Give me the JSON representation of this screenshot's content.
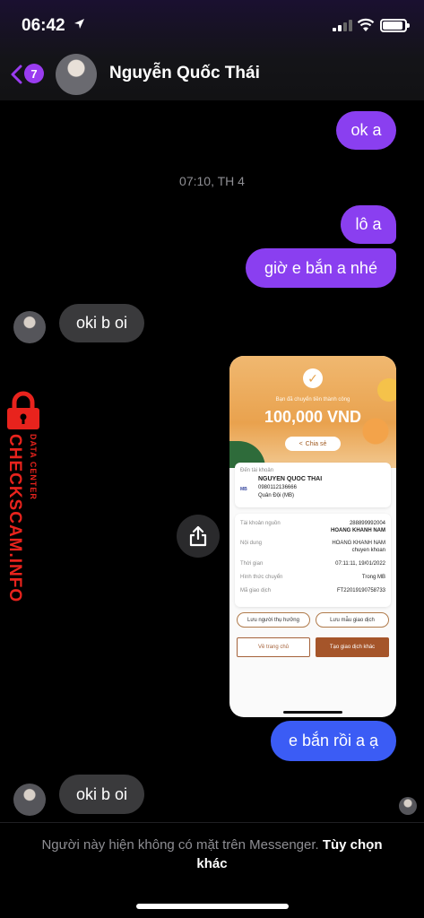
{
  "status_bar": {
    "time": "06:42"
  },
  "header": {
    "back_badge": "7",
    "contact_name": "Nguyễn Quốc Thái"
  },
  "messages": {
    "m1": "ok a",
    "time_separator": "07:10, TH 4",
    "m2": "lô a",
    "m3": "giờ e bắn a nhé",
    "m4": "oki b oi",
    "m5": "e bắn rồi a ạ",
    "m6": "oki b oi"
  },
  "receipt": {
    "subtitle": "Bạn đã chuyển tiền thành công",
    "amount": "100,000 VND",
    "share_label": "Chia sẻ",
    "to_account_label": "Đến tài khoản",
    "recipient_name": "NGUYEN QUOC THAI",
    "recipient_account": "0980112136666",
    "recipient_bank": "Quân Đội (MB)",
    "bank_logo": "MB",
    "rows": [
      {
        "label": "Tài khoản nguồn",
        "value": "288899992004",
        "value2": "HOANG KHANH NAM"
      },
      {
        "label": "Nội dung",
        "value": "HOANG KHANH NAM",
        "value2": "chuyen khoan"
      },
      {
        "label": "Thời gian",
        "value": "07:11:11, 19/01/2022"
      },
      {
        "label": "Hình thức chuyển",
        "value": "Trong MB"
      },
      {
        "label": "Mã giao dịch",
        "value": "FT22019190758733"
      }
    ],
    "save_beneficiary": "Lưu người thụ hưởng",
    "save_template": "Lưu mẫu giao dịch",
    "home_button": "Về trang chủ",
    "new_transaction_button": "Tạo giao dịch khác"
  },
  "watermark": {
    "main": "CHECKSCAM.INFO",
    "small": "DATA CENTER"
  },
  "footer": {
    "note": "Người này hiện không có mặt trên Messenger. ",
    "link": "Tùy chọn khác"
  },
  "colors": {
    "outgoing": "#8a3ff0",
    "outgoing_blue": "#3b5cf5",
    "incoming": "#3a3a3c",
    "watermark": "#e8231d"
  }
}
